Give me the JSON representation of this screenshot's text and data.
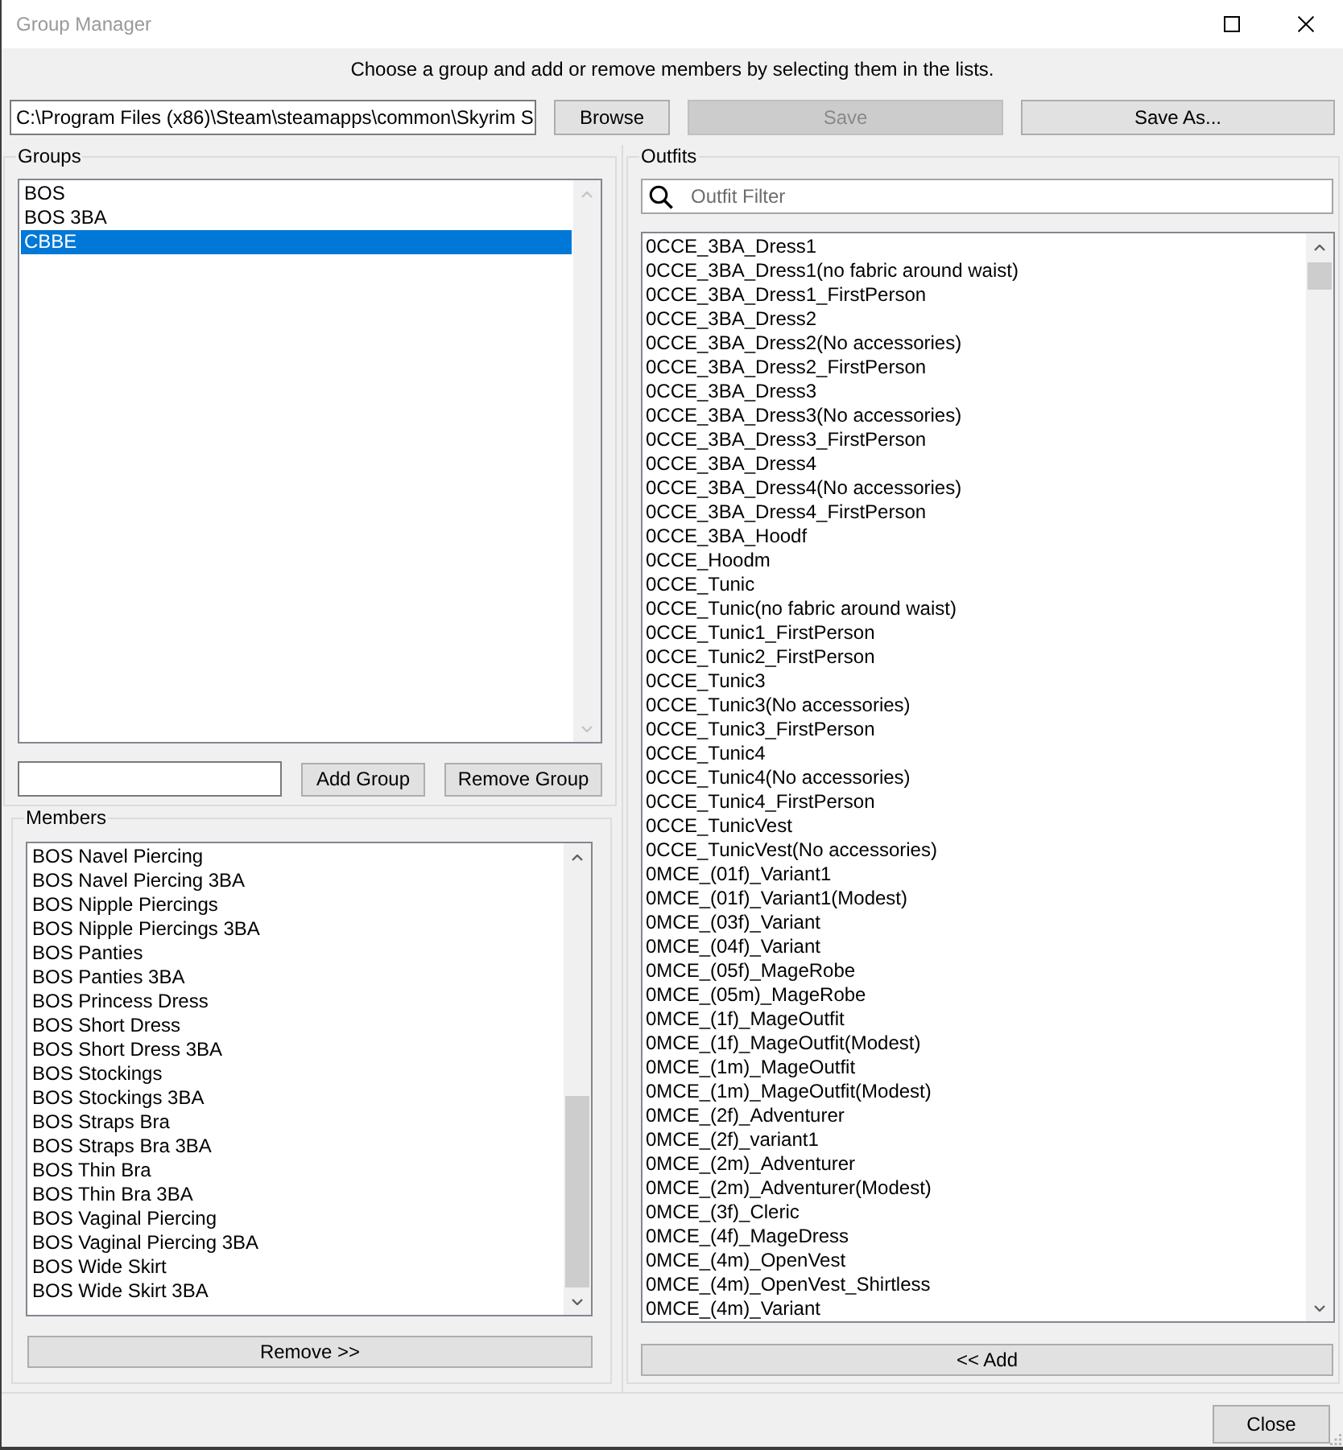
{
  "window": {
    "title": "Group Manager",
    "controls": [
      {
        "kind": "maximize"
      },
      {
        "kind": "close"
      }
    ]
  },
  "instruction": "Choose a group and add or remove members by selecting them in the lists.",
  "path_field": {
    "value": "C:\\Program Files (x86)\\Steam\\steamapps\\common\\Skyrim S"
  },
  "browse_button": {
    "label": "Browse",
    "disabled": false
  },
  "save_button": {
    "label": "Save",
    "disabled": true
  },
  "save_as_button": {
    "label": "Save As...",
    "disabled": false
  },
  "groups": {
    "title": "Groups",
    "items": [
      {
        "label": "BOS",
        "selected": false
      },
      {
        "label": "BOS 3BA",
        "selected": false
      },
      {
        "label": "CBBE",
        "selected": true
      }
    ],
    "add_button": "Add Group",
    "remove_button": "Remove Group"
  },
  "members": {
    "title": "Members",
    "items": [
      {
        "label": "BOS Navel Piercing",
        "selected": false
      },
      {
        "label": "BOS Navel Piercing 3BA",
        "selected": false
      },
      {
        "label": "BOS Nipple Piercings",
        "selected": false
      },
      {
        "label": "BOS Nipple Piercings 3BA",
        "selected": false
      },
      {
        "label": "BOS Panties",
        "selected": false
      },
      {
        "label": "BOS Panties 3BA",
        "selected": false
      },
      {
        "label": "BOS Princess Dress",
        "selected": false
      },
      {
        "label": "BOS Short Dress",
        "selected": false
      },
      {
        "label": "BOS Short Dress 3BA",
        "selected": false
      },
      {
        "label": "BOS Stockings",
        "selected": false
      },
      {
        "label": "BOS Stockings 3BA",
        "selected": false
      },
      {
        "label": "BOS Straps Bra",
        "selected": false
      },
      {
        "label": "BOS Straps Bra 3BA",
        "selected": false
      },
      {
        "label": "BOS Thin Bra",
        "selected": false
      },
      {
        "label": "BOS Thin Bra 3BA",
        "selected": false
      },
      {
        "label": "BOS Vaginal Piercing",
        "selected": false
      },
      {
        "label": "BOS Vaginal Piercing 3BA",
        "selected": false
      },
      {
        "label": "BOS Wide Skirt",
        "selected": false
      },
      {
        "label": "BOS Wide Skirt 3BA",
        "selected": false
      }
    ],
    "remove_button": "Remove >>"
  },
  "outfits": {
    "title": "Outfits",
    "filter": {
      "placeholder": "Outfit Filter"
    },
    "items": [
      {
        "label": "0CCE_3BA_Dress1",
        "selected": false
      },
      {
        "label": "0CCE_3BA_Dress1(no fabric around waist)",
        "selected": false
      },
      {
        "label": "0CCE_3BA_Dress1_FirstPerson",
        "selected": false
      },
      {
        "label": "0CCE_3BA_Dress2",
        "selected": false
      },
      {
        "label": "0CCE_3BA_Dress2(No accessories)",
        "selected": false
      },
      {
        "label": "0CCE_3BA_Dress2_FirstPerson",
        "selected": false
      },
      {
        "label": "0CCE_3BA_Dress3",
        "selected": false
      },
      {
        "label": "0CCE_3BA_Dress3(No accessories)",
        "selected": false
      },
      {
        "label": "0CCE_3BA_Dress3_FirstPerson",
        "selected": false
      },
      {
        "label": "0CCE_3BA_Dress4",
        "selected": false
      },
      {
        "label": "0CCE_3BA_Dress4(No accessories)",
        "selected": false
      },
      {
        "label": "0CCE_3BA_Dress4_FirstPerson",
        "selected": false
      },
      {
        "label": "0CCE_3BA_Hoodf",
        "selected": false
      },
      {
        "label": "0CCE_Hoodm",
        "selected": false
      },
      {
        "label": "0CCE_Tunic",
        "selected": false
      },
      {
        "label": "0CCE_Tunic(no fabric around waist)",
        "selected": false
      },
      {
        "label": "0CCE_Tunic1_FirstPerson",
        "selected": false
      },
      {
        "label": "0CCE_Tunic2_FirstPerson",
        "selected": false
      },
      {
        "label": "0CCE_Tunic3",
        "selected": false
      },
      {
        "label": "0CCE_Tunic3(No accessories)",
        "selected": false
      },
      {
        "label": "0CCE_Tunic3_FirstPerson",
        "selected": false
      },
      {
        "label": "0CCE_Tunic4",
        "selected": false
      },
      {
        "label": "0CCE_Tunic4(No accessories)",
        "selected": false
      },
      {
        "label": "0CCE_Tunic4_FirstPerson",
        "selected": false
      },
      {
        "label": "0CCE_TunicVest",
        "selected": false
      },
      {
        "label": "0CCE_TunicVest(No accessories)",
        "selected": false
      },
      {
        "label": "0MCE_(01f)_Variant1",
        "selected": false
      },
      {
        "label": "0MCE_(01f)_Variant1(Modest)",
        "selected": false
      },
      {
        "label": "0MCE_(03f)_Variant",
        "selected": false
      },
      {
        "label": "0MCE_(04f)_Variant",
        "selected": false
      },
      {
        "label": "0MCE_(05f)_MageRobe",
        "selected": false
      },
      {
        "label": "0MCE_(05m)_MageRobe",
        "selected": false
      },
      {
        "label": "0MCE_(1f)_MageOutfit",
        "selected": false
      },
      {
        "label": "0MCE_(1f)_MageOutfit(Modest)",
        "selected": false
      },
      {
        "label": "0MCE_(1m)_MageOutfit",
        "selected": false
      },
      {
        "label": "0MCE_(1m)_MageOutfit(Modest)",
        "selected": false
      },
      {
        "label": "0MCE_(2f)_Adventurer",
        "selected": false
      },
      {
        "label": "0MCE_(2f)_variant1",
        "selected": false
      },
      {
        "label": "0MCE_(2m)_Adventurer",
        "selected": false
      },
      {
        "label": "0MCE_(2m)_Adventurer(Modest)",
        "selected": false
      },
      {
        "label": "0MCE_(3f)_Cleric",
        "selected": false
      },
      {
        "label": "0MCE_(4f)_MageDress",
        "selected": false
      },
      {
        "label": "0MCE_(4m)_OpenVest",
        "selected": false
      },
      {
        "label": "0MCE_(4m)_OpenVest_Shirtless",
        "selected": false
      },
      {
        "label": "0MCE_(4m)_Variant",
        "selected": false
      }
    ],
    "add_button": "<< Add"
  },
  "close_button": "Close"
}
